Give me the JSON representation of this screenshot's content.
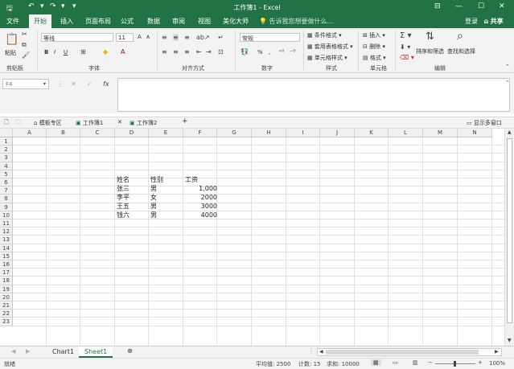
{
  "window": {
    "title": "工作簿1 - Excel",
    "qat": {
      "save_icon": "save-icon",
      "undo_icon": "undo-icon",
      "redo_icon": "redo-icon",
      "customize_icon": "chevron-down-icon"
    },
    "controls": {
      "ribbon_display": "⊟",
      "minimize": "—",
      "restore": "☐",
      "close": "✕"
    }
  },
  "ribbon_tabs": [
    "文件",
    "开始",
    "插入",
    "页面布局",
    "公式",
    "数据",
    "审阅",
    "视图",
    "美化大师"
  ],
  "active_tab": "开始",
  "tell_me": "告诉我您想要做什么...",
  "account": {
    "login": "登录",
    "share": "共享"
  },
  "ribbon": {
    "clipboard": {
      "label": "剪贴板",
      "paste": "粘贴"
    },
    "font": {
      "label": "字体",
      "family": "等线",
      "size": "11",
      "bold": "B",
      "italic": "I",
      "underline": "U",
      "grow": "A",
      "shrink": "A"
    },
    "alignment": {
      "label": "对齐方式"
    },
    "number": {
      "label": "数字",
      "format": "常规",
      "percent": "%",
      "comma": ","
    },
    "styles": {
      "label": "样式",
      "conditional": "条件格式",
      "table": "套用表格格式",
      "cell_styles": "单元格样式"
    },
    "cells": {
      "label": "单元格",
      "insert": "插入",
      "delete": "删除",
      "format": "格式"
    },
    "editing": {
      "label": "编辑",
      "sort_filter": "排序和筛选",
      "find_select": "查找和选择"
    }
  },
  "formula_bar": {
    "name_box": "F4",
    "fx": "fx",
    "cancel": "✕",
    "enter": "✓",
    "value": ""
  },
  "doc_tabs": {
    "template_zone": "模板专区",
    "book1": "工作簿1",
    "book2": "工作簿2",
    "add": "+",
    "multi_window": "显示多窗口"
  },
  "columns": [
    "A",
    "B",
    "C",
    "D",
    "E",
    "F",
    "G",
    "H",
    "I",
    "J",
    "K",
    "L",
    "M",
    "N"
  ],
  "rows": [
    "1",
    "2",
    "3",
    "4",
    "5",
    "6",
    "7",
    "8",
    "9",
    "10",
    "11",
    "12",
    "13",
    "14",
    "15",
    "16",
    "17",
    "18",
    "19",
    "20",
    "21",
    "22",
    "23"
  ],
  "cells": {
    "headers": {
      "name": "姓名",
      "gender": "性别",
      "salary": "工资"
    },
    "data": [
      {
        "name": "张三",
        "gender": "男",
        "salary": "1,000"
      },
      {
        "name": "李平",
        "gender": "女",
        "salary": "2000"
      },
      {
        "name": "王五",
        "gender": "男",
        "salary": "3000"
      },
      {
        "name": "钱六",
        "gender": "男",
        "salary": "4000"
      }
    ]
  },
  "sheets": {
    "tab1": "Chart1",
    "tab2": "Sheet1",
    "active": "Sheet1"
  },
  "status": {
    "ready": "就绪",
    "average": "平均值: 2500",
    "count": "计数: 15",
    "sum": "求和: 10000",
    "zoom": "100%"
  },
  "colors": {
    "brand": "#217346",
    "ribbon_bg": "#f3f3f3",
    "grid_line": "#e1e1e1"
  }
}
